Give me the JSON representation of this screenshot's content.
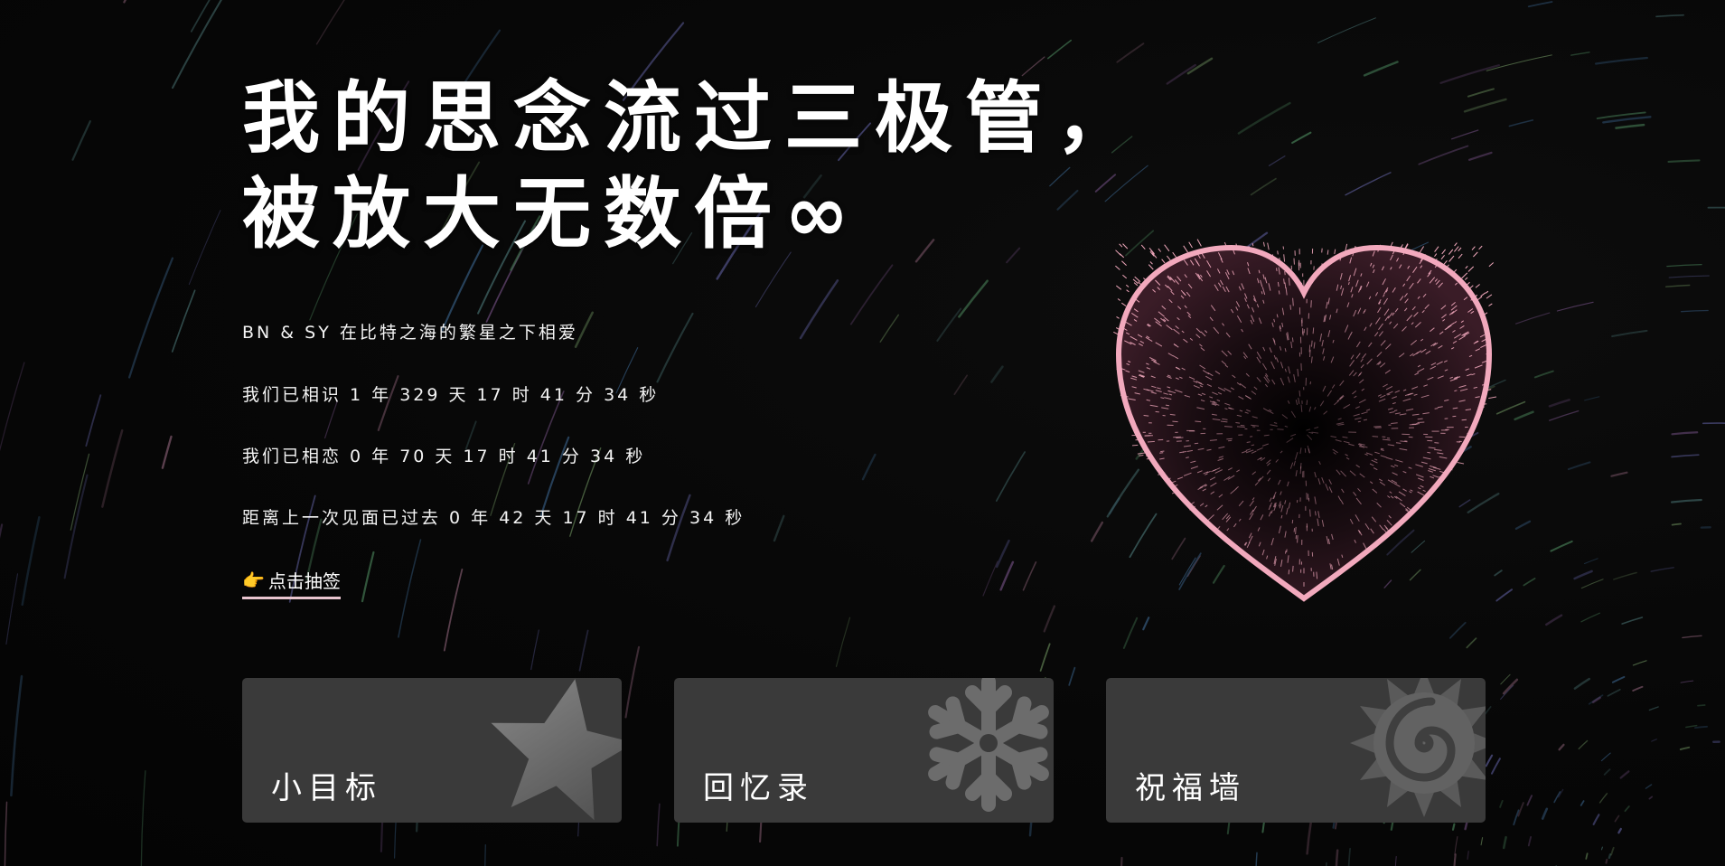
{
  "hero": {
    "line1": "我的思念流过三极管，",
    "line2": "被放大无数倍∞"
  },
  "info": {
    "couple": "BN & SY 在比特之海的繁星之下相爱",
    "known": "我们已相识 1 年 329 天 17 时 41 分 34 秒",
    "love": "我们已相恋 0 年 70 天 17 时 41 分 34 秒",
    "last_meet": "距离上一次见面已过去 0 年 42 天 17 时 41 分 34 秒"
  },
  "draw": {
    "icon": "pointing-hand-icon",
    "label": "点击抽签"
  },
  "heart": {
    "icon": "heart-icon",
    "color": "#f2a9bd"
  },
  "cards": [
    {
      "label": "小目标",
      "icon": "star-icon"
    },
    {
      "label": "回忆录",
      "icon": "snowflake-icon"
    },
    {
      "label": "祝福墙",
      "icon": "spiral-sun-icon"
    }
  ],
  "colors": {
    "background": "#060606",
    "card": "#3a3a3a",
    "accent": "#f2a9bd"
  }
}
